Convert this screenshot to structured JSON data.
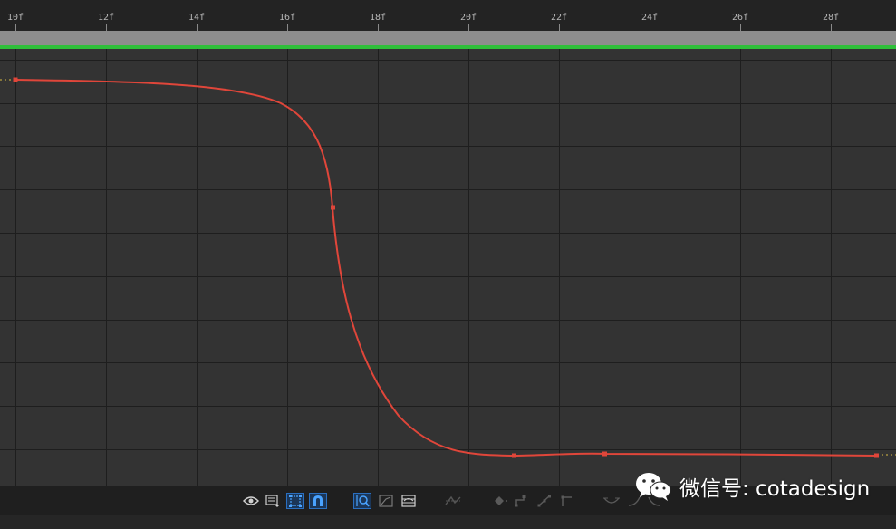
{
  "ruler": {
    "labels": [
      "10f",
      "12f",
      "14f",
      "16f",
      "18f",
      "20f",
      "22f",
      "24f",
      "26f",
      "28f"
    ]
  },
  "graph": {
    "curve_color": "#e0463a",
    "grid_color": "#1e1e1e",
    "background_color": "#333333"
  },
  "toolbar": {
    "icons": [
      "eye-icon",
      "graph-menu-icon",
      "transform-box-icon",
      "snap-icon",
      "fit-selection-icon",
      "fit-all-icon",
      "edit-speed-icon",
      "separate-dimensions-icon",
      "convert-keyframe-icon",
      "hold-keyframe-icon",
      "auto-bezier-icon",
      "roving-icon",
      "easy-ease-icon",
      "ease-in-icon",
      "ease-out-icon"
    ]
  },
  "watermark": {
    "text": "微信号: cotadesign"
  }
}
